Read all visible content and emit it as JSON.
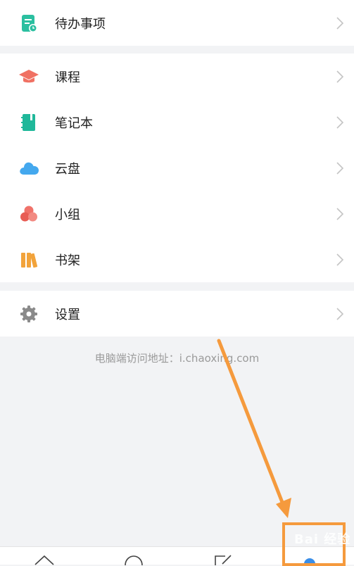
{
  "menu": {
    "todo": {
      "label": "待办事项"
    },
    "courses": {
      "label": "课程"
    },
    "notebook": {
      "label": "笔记本"
    },
    "cloud": {
      "label": "云盘"
    },
    "group": {
      "label": "小组"
    },
    "bookshelf": {
      "label": "书架"
    },
    "settings": {
      "label": "设置"
    }
  },
  "footer": {
    "pc_address": "电脑端访问地址：i.chaoxing.com"
  },
  "watermark": {
    "text": "Bai 经验"
  },
  "colors": {
    "todo_icon": "#2bbfa0",
    "course_icon": "#f07163",
    "notebook_icon": "#1fb89a",
    "cloud_icon": "#44a8ee",
    "group_icon": "#f0726a",
    "bookshelf_icon": "#f2a33b",
    "settings_icon": "#8a8a8a",
    "annotation": "#f59a3d"
  }
}
